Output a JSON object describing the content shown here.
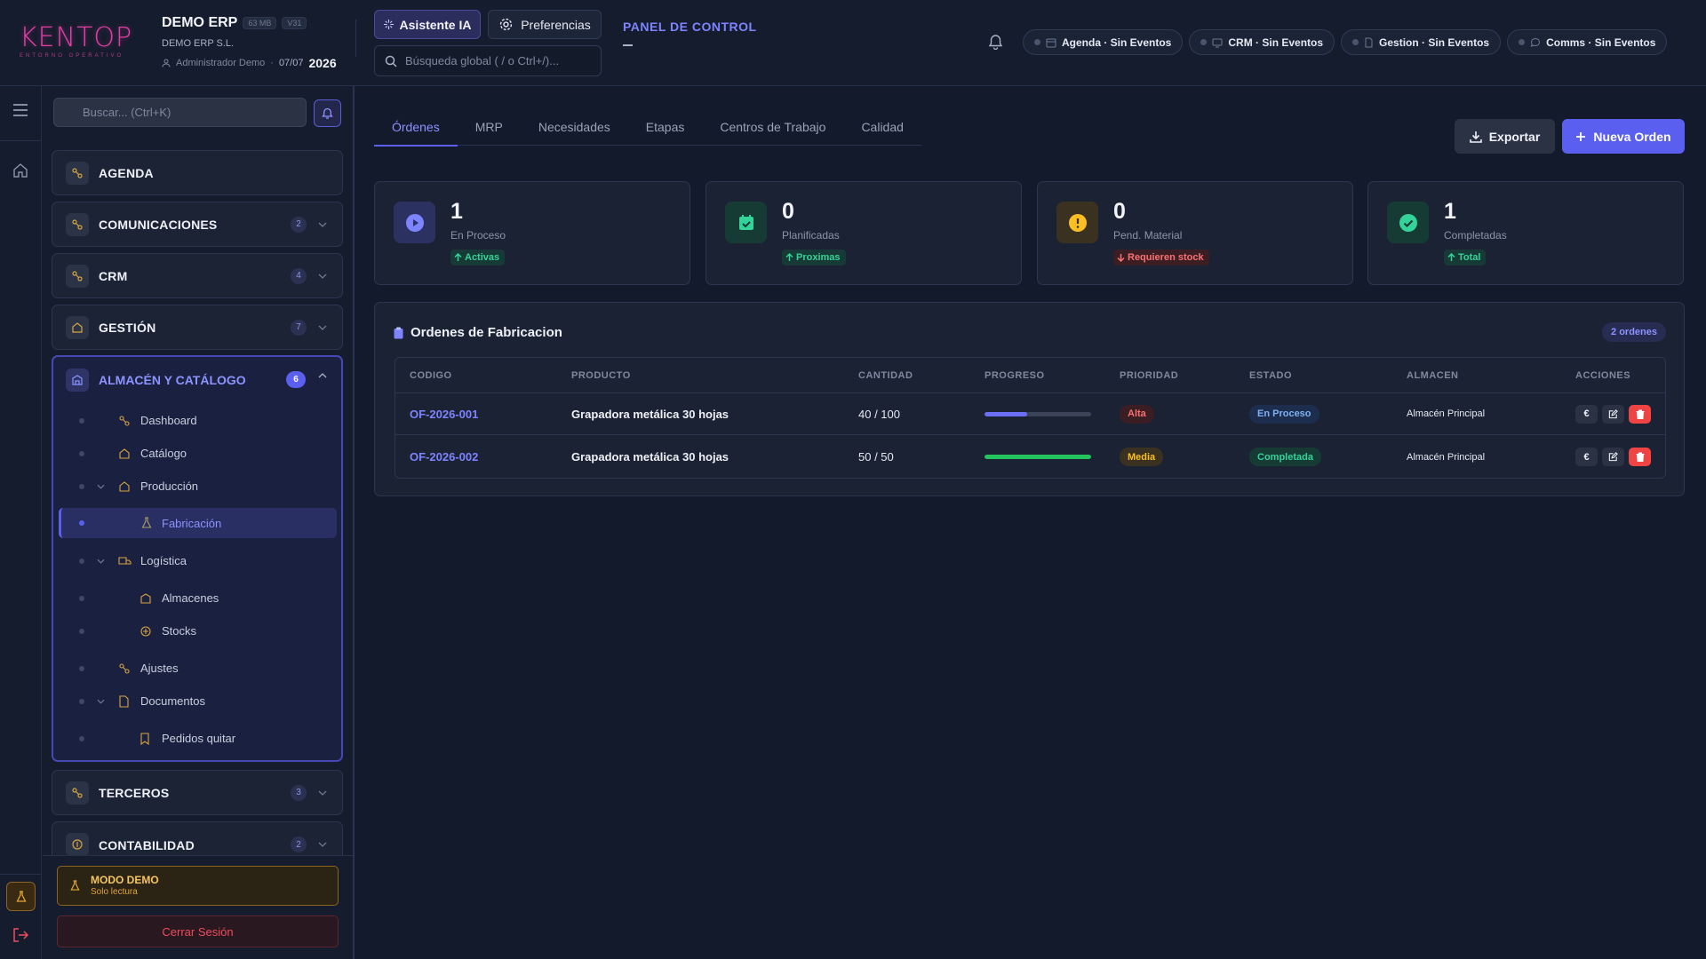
{
  "header": {
    "logo_text": "KENTOP",
    "logo_sub": "ENTORNO OPERATIVO",
    "company_name": "DEMO ERP",
    "size_badge": "63 MB",
    "version_badge": "V31",
    "company_legal": "DEMO ERP S.L.",
    "user": "Administrador Demo",
    "date": "07/07",
    "year": "2026",
    "ai_button": "Asistente IA",
    "prefs_button": "Preferencias",
    "search_placeholder": "Búsqueda global ( / o Ctrl+/)...",
    "panel_title": "PANEL DE CONTROL",
    "status_pills": [
      {
        "label": "Agenda · Sin Eventos",
        "icon": "calendar-icon"
      },
      {
        "label": "CRM · Sin Eventos",
        "icon": "monitor-icon"
      },
      {
        "label": "Gestion · Sin Eventos",
        "icon": "document-icon"
      },
      {
        "label": "Comms · Sin Eventos",
        "icon": "chat-icon"
      }
    ]
  },
  "sidebar": {
    "search_placeholder": "Buscar... (Ctrl+K)",
    "sections": [
      {
        "label": "AGENDA",
        "count": null
      },
      {
        "label": "COMUNICACIONES",
        "count": "2"
      },
      {
        "label": "CRM",
        "count": "4"
      },
      {
        "label": "GESTIÓN",
        "count": "7"
      }
    ],
    "open_section": {
      "label": "ALMACÉN Y CATÁLOGO",
      "count": "6",
      "items": [
        {
          "label": "Dashboard"
        },
        {
          "label": "Catálogo"
        },
        {
          "label": "Producción"
        },
        {
          "label": "Fabricación"
        },
        {
          "label": "Logística"
        },
        {
          "label": "Almacenes"
        },
        {
          "label": "Stocks"
        },
        {
          "label": "Ajustes"
        },
        {
          "label": "Documentos"
        },
        {
          "label": "Pedidos quitar"
        }
      ]
    },
    "lower_sections": [
      {
        "label": "TERCEROS",
        "count": "3"
      },
      {
        "label": "CONTABILIDAD",
        "count": "2"
      }
    ],
    "demo_title": "MODO DEMO",
    "demo_sub": "Solo lectura",
    "logout": "Cerrar Sesión"
  },
  "main": {
    "tabs": [
      "Órdenes",
      "MRP",
      "Necesidades",
      "Etapas",
      "Centros de Trabajo",
      "Calidad"
    ],
    "active_tab": "Órdenes",
    "export_button": "Exportar",
    "new_button": "Nueva Orden",
    "stats": [
      {
        "value": "1",
        "label": "En Proceso",
        "badge": "Activas",
        "color": "#7d84ff"
      },
      {
        "value": "0",
        "label": "Planificadas",
        "badge": "Proximas",
        "color": "#34d399"
      },
      {
        "value": "0",
        "label": "Pend. Material",
        "badge": "Requieren stock",
        "color": "#fbbf24"
      },
      {
        "value": "1",
        "label": "Completadas",
        "badge": "Total",
        "color": "#34d399"
      }
    ],
    "orders": {
      "title": "Ordenes de Fabricacion",
      "count_badge": "2 ordenes",
      "columns": [
        "CODIGO",
        "PRODUCTO",
        "CANTIDAD",
        "PROGRESO",
        "PRIORIDAD",
        "ESTADO",
        "ALMACEN",
        "ACCIONES"
      ],
      "rows": [
        {
          "code": "OF-2026-001",
          "product": "Grapadora metálica 30 hojas",
          "qty": "40 / 100",
          "progress": 0.4,
          "priority": "Alta",
          "status": "En Proceso",
          "warehouse": "Almacén Principal"
        },
        {
          "code": "OF-2026-002",
          "product": "Grapadora metálica 30 hojas",
          "qty": "50 / 50",
          "progress": 1.0,
          "priority": "Media",
          "status": "Completada",
          "warehouse": "Almacén Principal"
        }
      ],
      "action_euro": "€"
    }
  }
}
